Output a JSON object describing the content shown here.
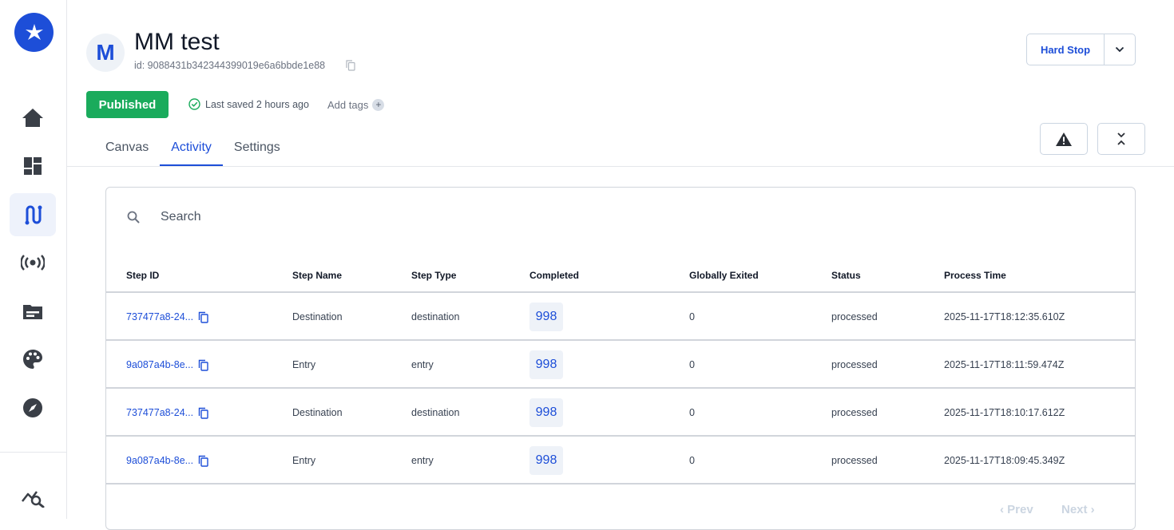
{
  "header": {
    "avatar_letter": "M",
    "title": "MM test",
    "id_text": "id: 9088431b342344399019e6a6bbde1e88",
    "hard_stop_label": "Hard Stop",
    "status_badge": "Published",
    "last_saved": "Last saved 2 hours ago",
    "add_tags": "Add tags"
  },
  "tabs": [
    {
      "label": "Canvas"
    },
    {
      "label": "Activity"
    },
    {
      "label": "Settings"
    }
  ],
  "search": {
    "placeholder": "Search"
  },
  "table": {
    "headers": [
      "Step ID",
      "Step Name",
      "Step Type",
      "Completed",
      "Globally Exited",
      "Status",
      "Process Time"
    ],
    "rows": [
      {
        "step_id": "737477a8-24...",
        "step_name": "Destination",
        "step_type": "destination",
        "completed": "998",
        "globally_exited": "0",
        "status": "processed",
        "process_time": "2025-11-17T18:12:35.610Z"
      },
      {
        "step_id": "9a087a4b-8e...",
        "step_name": "Entry",
        "step_type": "entry",
        "completed": "998",
        "globally_exited": "0",
        "status": "processed",
        "process_time": "2025-11-17T18:11:59.474Z"
      },
      {
        "step_id": "737477a8-24...",
        "step_name": "Destination",
        "step_type": "destination",
        "completed": "998",
        "globally_exited": "0",
        "status": "processed",
        "process_time": "2025-11-17T18:10:17.612Z"
      },
      {
        "step_id": "9a087a4b-8e...",
        "step_name": "Entry",
        "step_type": "entry",
        "completed": "998",
        "globally_exited": "0",
        "status": "processed",
        "process_time": "2025-11-17T18:09:45.349Z"
      }
    ]
  },
  "pagination": {
    "prev": "‹ Prev",
    "next": "Next ›"
  },
  "sidebar": {
    "items": [
      {
        "icon": "home-icon"
      },
      {
        "icon": "dashboard-icon"
      },
      {
        "icon": "journeys-icon",
        "active": true
      },
      {
        "icon": "broadcast-icon"
      },
      {
        "icon": "folder-icon"
      },
      {
        "icon": "palette-icon"
      },
      {
        "icon": "compass-icon"
      },
      {
        "icon": "analytics-search-icon"
      }
    ]
  },
  "colors": {
    "accent": "#1d4ed8",
    "published": "#1aab5c",
    "border": "#d1d5db"
  }
}
